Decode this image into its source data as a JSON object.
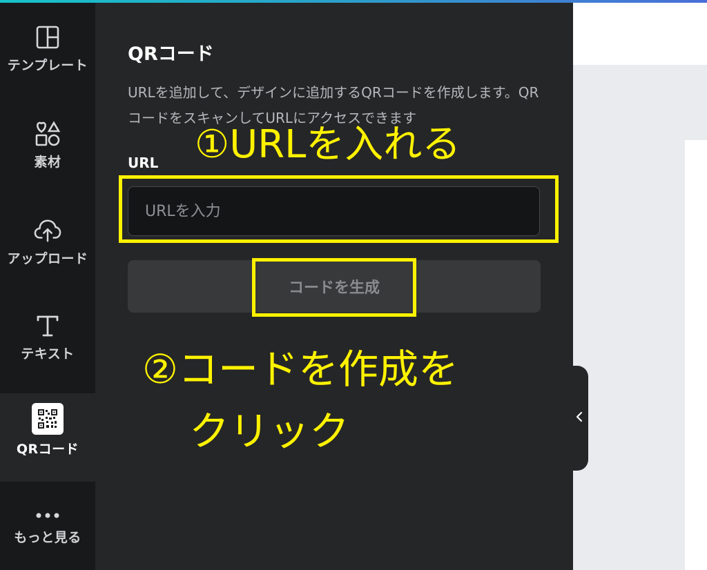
{
  "rail": {
    "items": [
      {
        "label": "テンプレート",
        "icon": "template-icon"
      },
      {
        "label": "素材",
        "icon": "elements-icon"
      },
      {
        "label": "アップロード",
        "icon": "upload-icon"
      },
      {
        "label": "テキスト",
        "icon": "text-icon"
      },
      {
        "label": "QRコード",
        "icon": "qr-code-icon",
        "active": true
      },
      {
        "label": "もっと見る",
        "icon": "more-icon"
      }
    ]
  },
  "panel": {
    "title": "QRコード",
    "description": "URLを追加して、デザインに追加するQRコードを作成します。QRコードをスキャンしてURLにアクセスできます",
    "url_label": "URL",
    "url_placeholder": "URLを入力",
    "url_value": "",
    "generate_button_label": "コードを生成"
  },
  "annotations": {
    "step1": "①URLを入れる",
    "step2_line1": "②コードを作成を",
    "step2_line2": "クリック"
  },
  "colors": {
    "annotation": "#fff200",
    "panel_bg": "#252627",
    "rail_bg": "#18191b"
  }
}
